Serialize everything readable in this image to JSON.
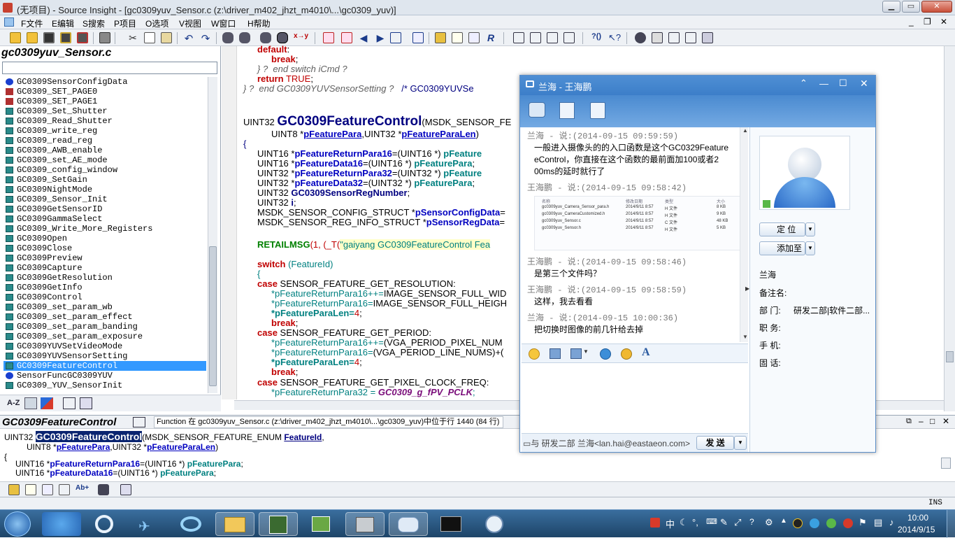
{
  "window": {
    "title": "(无项目) - Source Insight - [gc0309yuv_Sensor.c (z:\\driver_m402_jhzt_m4010\\...\\gc0309_yuv)]"
  },
  "menu": [
    "F文件",
    "E编辑",
    "S搜索",
    "P项目",
    "O选项",
    "V视图",
    "W窗口",
    "H帮助"
  ],
  "symbol_window": {
    "title": "gc0309yuv_Sensor.c",
    "symbols": [
      {
        "label": "GC0309SensorConfigData",
        "icon": "struct-icon",
        "color": "#1a3fcf"
      },
      {
        "label": "GC0309_SET_PAGE0",
        "icon": "define-icon",
        "color": "#b03030"
      },
      {
        "label": "GC0309_SET_PAGE1",
        "icon": "define-icon",
        "color": "#b03030"
      },
      {
        "label": "GC0309_Set_Shutter",
        "icon": "function-icon",
        "color": "#2a8a8a"
      },
      {
        "label": "GC0309_Read_Shutter",
        "icon": "function-icon",
        "color": "#2a8a8a"
      },
      {
        "label": "GC0309_write_reg",
        "icon": "function-icon",
        "color": "#2a8a8a"
      },
      {
        "label": "GC0309_read_reg",
        "icon": "function-icon",
        "color": "#2a8a8a"
      },
      {
        "label": "GC0309_AWB_enable",
        "icon": "function-icon",
        "color": "#2a8a8a"
      },
      {
        "label": "GC0309_set_AE_mode",
        "icon": "function-icon",
        "color": "#2a8a8a"
      },
      {
        "label": "GC0309_config_window",
        "icon": "function-icon",
        "color": "#2a8a8a"
      },
      {
        "label": "GC0309_SetGain",
        "icon": "function-icon",
        "color": "#2a8a8a"
      },
      {
        "label": "GC0309NightMode",
        "icon": "function-icon",
        "color": "#2a8a8a"
      },
      {
        "label": "GC0309_Sensor_Init",
        "icon": "function-icon",
        "color": "#2a8a8a"
      },
      {
        "label": "GC0309GetSensorID",
        "icon": "function-icon",
        "color": "#2a8a8a"
      },
      {
        "label": "GC0309GammaSelect",
        "icon": "function-icon",
        "color": "#2a8a8a"
      },
      {
        "label": "GC0309_Write_More_Registers",
        "icon": "function-icon",
        "color": "#2a8a8a"
      },
      {
        "label": "GC0309Open",
        "icon": "function-icon",
        "color": "#2a8a8a"
      },
      {
        "label": "GC0309Close",
        "icon": "function-icon",
        "color": "#2a8a8a"
      },
      {
        "label": "GC0309Preview",
        "icon": "function-icon",
        "color": "#2a8a8a"
      },
      {
        "label": "GC0309Capture",
        "icon": "function-icon",
        "color": "#2a8a8a"
      },
      {
        "label": "GC0309GetResolution",
        "icon": "function-icon",
        "color": "#2a8a8a"
      },
      {
        "label": "GC0309GetInfo",
        "icon": "function-icon",
        "color": "#2a8a8a"
      },
      {
        "label": "GC0309Control",
        "icon": "function-icon",
        "color": "#2a8a8a"
      },
      {
        "label": "GC0309_set_param_wb",
        "icon": "function-icon",
        "color": "#2a8a8a"
      },
      {
        "label": "GC0309_set_param_effect",
        "icon": "function-icon",
        "color": "#2a8a8a"
      },
      {
        "label": "GC0309_set_param_banding",
        "icon": "function-icon",
        "color": "#2a8a8a"
      },
      {
        "label": "GC0309_set_param_exposure",
        "icon": "function-icon",
        "color": "#2a8a8a"
      },
      {
        "label": "GC0309YUVSetVideoMode",
        "icon": "function-icon",
        "color": "#2a8a8a"
      },
      {
        "label": "GC0309YUVSensorSetting",
        "icon": "function-icon",
        "color": "#2a8a8a"
      },
      {
        "label": "GC0309FeatureControl",
        "icon": "function-icon",
        "color": "#2a8a8a",
        "selected": true
      },
      {
        "label": "SensorFuncGC0309YUV",
        "icon": "struct-icon",
        "color": "#1a3fcf"
      },
      {
        "label": "GC0309_YUV_SensorInit",
        "icon": "function-icon",
        "color": "#2a8a8a"
      }
    ],
    "sort_label": "A-Z"
  },
  "code": {
    "l1": "default",
    "l2": "break",
    "l3": "} ?  end switch iCmd ?",
    "l4a": "return",
    "l4b": "TRUE",
    "l5a": "} ?  end GC0309YUVSensorSetting ?",
    "l5b": "/* GC0309YUVSe",
    "fn_type": "UINT32",
    "fn_name": "GC0309FeatureControl",
    "fn_param1": "(MSDK_SENSOR_FE",
    "p2a": "UINT8 *",
    "p2b": "pFeaturePara",
    "p2c": ",UINT32 *",
    "p2d": "pFeatureParaLen",
    "p2e": ")",
    "brace": "{",
    "d1a": "UINT16 *",
    "d1b": "pFeatureReturnPara16",
    "d1c": "=(UINT16 *) ",
    "d1d": "pFeature",
    "d2a": "UINT16 *",
    "d2b": "pFeatureData16",
    "d2c": "=(UINT16 *) ",
    "d2d": "pFeaturePara",
    "d3a": "UINT32 *",
    "d3b": "pFeatureReturnPara32",
    "d3c": "=(UINT32 *) ",
    "d3d": "pFeature",
    "d4a": "UINT32 *",
    "d4b": "pFeatureData32",
    "d4c": "=(UINT32 *) ",
    "d4d": "pFeaturePara",
    "d5a": "UINT32 ",
    "d5b": "GC0309SensorRegNumber",
    "d6a": "UINT32 ",
    "d6b": "i",
    "d7a": "MSDK_SENSOR_CONFIG_STRUCT *",
    "d7b": "pSensorConfigData",
    "d8a": "MSDK_SENSOR_REG_INFO_STRUCT *",
    "d8b": "pSensorRegData",
    "r1a": "RETAILMSG",
    "r1b": "(1, (_T(",
    "r1c": "\"gaiyang GC0309FeatureControl Fea",
    "s1a": "switch",
    "s1b": "(FeatureId)",
    "s2": "{",
    "c1a": "case",
    "c1b": "SENSOR_FEATURE_GET_RESOLUTION:",
    "c2a": "*pFeatureReturnPara16++=",
    "c2b": "IMAGE_SENSOR_FULL_WID",
    "c3a": "*pFeatureReturnPara16=",
    "c3b": "IMAGE_SENSOR_FULL_HEIGH",
    "c4a": "*pFeatureParaLen=",
    "c4b": "4",
    "c5": "break",
    "c6a": "case",
    "c6b": "SENSOR_FEATURE_GET_PERIOD:",
    "c7a": "*pFeatureReturnPara16++=",
    "c7b": "(VGA_PERIOD_PIXEL_NUM",
    "c8a": "*pFeatureReturnPara16=",
    "c8b": "(VGA_PERIOD_LINE_NUMS)+(",
    "c9a": "*pFeatureParaLen=",
    "c9b": "4",
    "c10": "break",
    "c11a": "case",
    "c11b": "SENSOR_FEATURE_GET_PIXEL_CLOCK_FREQ:",
    "c12a": "*pFeatureReturnPara32 = ",
    "c12b": "GC0309_g_fPV_PCLK"
  },
  "context": {
    "title": "GC0309FeatureControl",
    "info": "Function 在 gc0309yuv_Sensor.c (z:\\driver_m402_jhzt_m4010\\...\\gc0309_yuv)中位于行 1440 (84 行)",
    "l1a": "UINT32",
    "l1b": "GC0309FeatureControl",
    "l1c": "(MSDK_SENSOR_FEATURE_ENUM",
    "l1d": "FeatureId",
    "l2a": "UINT8 *",
    "l2b": "pFeaturePara",
    "l2c": ",UINT32 *",
    "l2d": "pFeatureParaLen",
    "l2e": ")",
    "l3": "{",
    "l4a": "UINT16 *",
    "l4b": "pFeatureReturnPara16",
    "l4c": "=(UINT16 *) ",
    "l4d": "pFeaturePara",
    "l5a": "UINT16 *",
    "l5b": "pFeatureData16",
    "l5c": "=(UINT16 *) ",
    "l5d": "pFeaturePara"
  },
  "status": {
    "mode": "INS"
  },
  "chat": {
    "title": "兰海 - 王海鹏",
    "messages": [
      {
        "sender": "兰海",
        "sep": " - ",
        "said": "说",
        "time": ":(2014-09-15 09:59:59)",
        "text1": "一般进入摄像头的的入口函数是这个GC0329Feature",
        "text2": "eControl，你直接在这个函数的最前面加100或者2",
        "text3": "00ms的延时就行了"
      },
      {
        "sender": "王海鹏",
        "sep": " - ",
        "said": "说",
        "time": ":(2014-09-15 09:58:42)"
      },
      {
        "sender": "王海鹏",
        "sep": " - ",
        "said": "说",
        "time": ":(2014-09-15 09:58:46)",
        "text1": "是第三个文件吗？"
      },
      {
        "sender": "王海鹏",
        "sep": " - ",
        "said": "说",
        "time": ":(2014-09-15 09:58:59)",
        "text1": "这样，我去看看"
      },
      {
        "sender": "兰海",
        "sep": " - ",
        "said": "说",
        "time": ":(2014-09-15 10:00:36)",
        "text1": "把切换时图像的前几针给去掉"
      }
    ],
    "file_table": {
      "headers": [
        "名称",
        "修改日期",
        "类型",
        "大小"
      ],
      "rows": [
        [
          "gc0309yuv_Camera_Sensor_para.h",
          "2014/9/11 8:57",
          "H 文件",
          "8 KB"
        ],
        [
          "gc0309yuv_CameraCustomized.h",
          "2014/9/11 8:57",
          "H 文件",
          "9 KB"
        ],
        [
          "gc0309yuv_Sensor.c",
          "2014/9/11 8:57",
          "C 文件",
          "48 KB"
        ],
        [
          "gc0309yuv_Sensor.h",
          "2014/9/11 8:57",
          "H 文件",
          "5 KB"
        ]
      ]
    },
    "sendbar_info": "与 研发二部 兰海<lan.hai@eastaeon.com>",
    "send_label": "发 送",
    "locate_label": "定  位",
    "add_label": "添加至",
    "contact": {
      "name": "兰海",
      "remark_label": "备注名:",
      "dept_label": "部  门:",
      "dept_value": "研发二部|软件二部...",
      "job_label": "职  务:",
      "mobile_label": "手  机:",
      "phone_label": "固  话:"
    }
  },
  "taskbar": {
    "time": "10:00",
    "date": "2014/9/15",
    "ime": "中"
  }
}
